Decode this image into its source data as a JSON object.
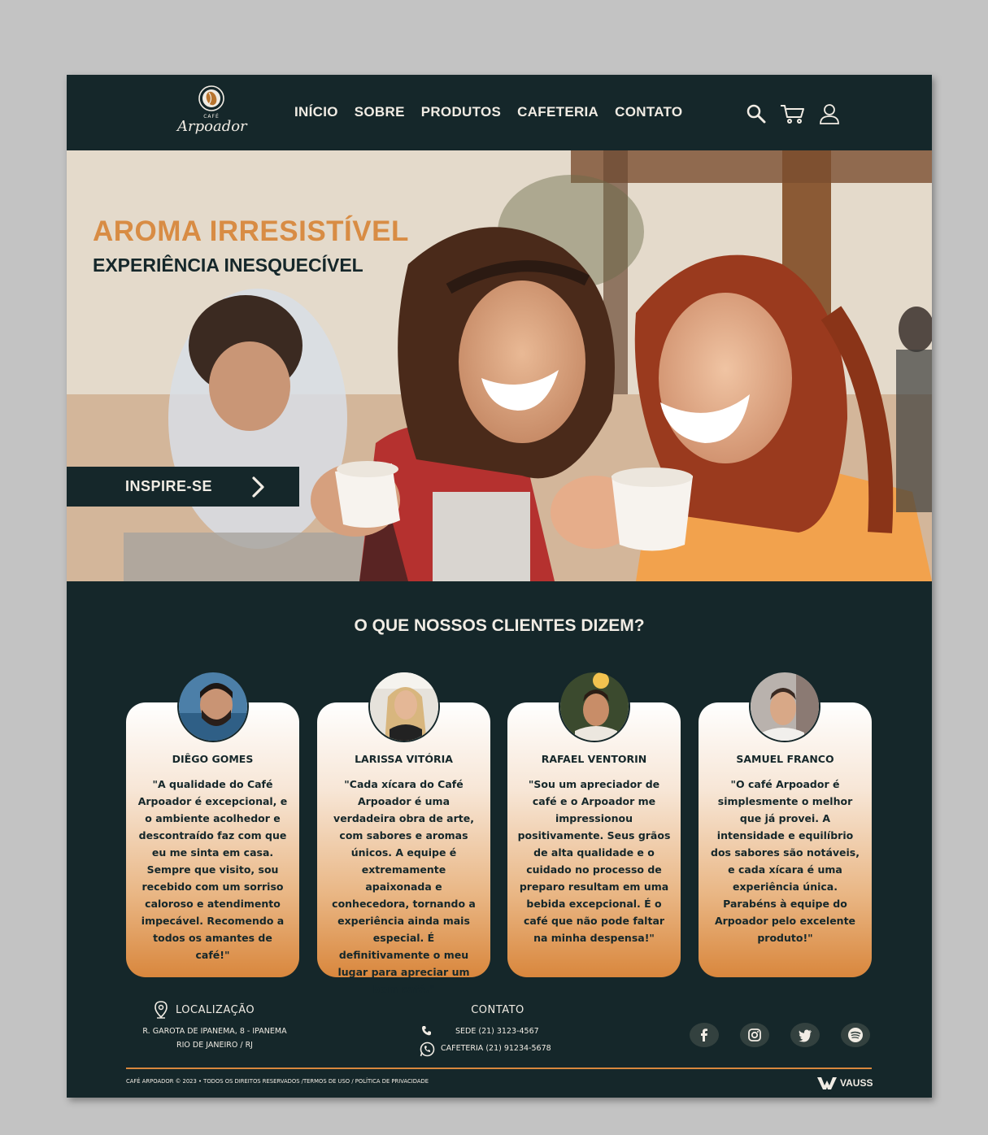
{
  "brand": {
    "logo_cafe": "CAFÉ",
    "logo_name": "Arpoador"
  },
  "nav": {
    "items": [
      "INÍCIO",
      "SOBRE",
      "PRODUTOS",
      "CAFETERIA",
      "CONTATO"
    ]
  },
  "header_icons": [
    "search-icon",
    "cart-icon",
    "user-icon"
  ],
  "hero": {
    "title": "AROMA IRRESISTÍVEL",
    "subtitle": "EXPERIÊNCIA INESQUECÍVEL",
    "cta_label": "INSPIRE-SE"
  },
  "testimonials": {
    "title": "O QUE NOSSOS CLIENTES DIZEM?",
    "items": [
      {
        "name": "DIÊGO GOMES",
        "text": "\"A qualidade do Café Arpoador é excepcional, e o ambiente acolhedor e descontraído faz com que eu me sinta em casa. Sempre que visito, sou recebido com um sorriso caloroso e atendimento impecável. Recomendo a todos os amantes de café!\""
      },
      {
        "name": "LARISSA VITÓRIA",
        "text": "\"Cada xícara do Café Arpoador  é uma verdadeira obra de arte, com sabores e aromas únicos. A equipe é extremamente apaixonada e conhecedora, tornando a experiência ainda mais especial. É definitivamente o meu lugar para apreciar um bom café.\""
      },
      {
        "name": "RAFAEL VENTORIN",
        "text": "\"Sou um apreciador de café e o Arpoador me impressionou positivamente. Seus grãos de alta qualidade e o cuidado no processo de preparo resultam em uma bebida excepcional. É o café que não pode faltar na minha despensa!\""
      },
      {
        "name": "SAMUEL FRANCO",
        "text": "\"O café Arpoador é simplesmente o melhor que já provei. A intensidade e equilíbrio dos sabores são notáveis, e cada xícara é uma experiência única. Parabéns à equipe do Arpoador pelo excelente produto!\""
      }
    ]
  },
  "footer": {
    "location_title": "LOCALIZAÇÃO",
    "address_line1": "R. GAROTA DE IPANEMA, 8 - IPANEMA",
    "address_line2": "RIO DE JANEIRO / RJ",
    "contact_title": "CONTATO",
    "phone_sede": "SEDE (21) 3123-4567",
    "phone_cafeteria": "CAFETERIA (21) 91234-5678",
    "social": [
      "facebook-icon",
      "instagram-icon",
      "twitter-icon",
      "spotify-icon"
    ],
    "copyright": "CAFÉ ARPOADOR © 2023 • TODOS OS DIREITOS RESERVADOS /TERMOS DE USO / POLÍTICA DE PRIVACIDADE",
    "agency": "VAUSS"
  },
  "colors": {
    "dark": "#15272a",
    "accent": "#d9873d",
    "cream": "#f1ece4",
    "background": "#c3c3c3"
  }
}
